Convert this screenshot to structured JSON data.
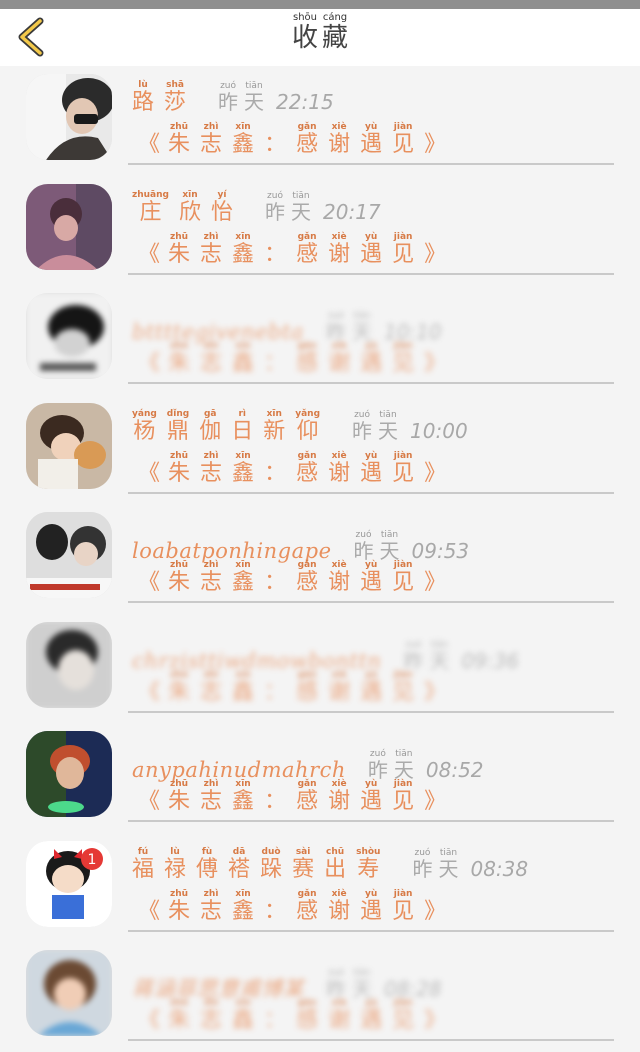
{
  "header": {
    "title_chars": [
      {
        "char": "收",
        "pinyin": "shōu"
      },
      {
        "char": "藏",
        "pinyin": "cáng"
      }
    ]
  },
  "message_chars": [
    {
      "char": "朱",
      "pinyin": "zhū"
    },
    {
      "char": "志",
      "pinyin": "zhì"
    },
    {
      "char": "鑫",
      "pinyin": "xīn"
    },
    {
      "char": "：",
      "pinyin": ""
    },
    {
      "char": "感",
      "pinyin": "gǎn"
    },
    {
      "char": "谢",
      "pinyin": "xiè"
    },
    {
      "char": "遇",
      "pinyin": "yù"
    },
    {
      "char": "见",
      "pinyin": "jiàn"
    }
  ],
  "yesterday_chars": [
    {
      "char": "昨",
      "pinyin": "zuó"
    },
    {
      "char": "天",
      "pinyin": "tiān"
    }
  ],
  "items": [
    {
      "name_chars": [
        {
          "char": "路",
          "pinyin": "lù"
        },
        {
          "char": "莎",
          "pinyin": "shā"
        }
      ],
      "time": "22:15",
      "blurred": false
    },
    {
      "name_chars": [
        {
          "char": "庄",
          "pinyin": "zhuāng"
        },
        {
          "char": "欣",
          "pinyin": "xīn"
        },
        {
          "char": "怡",
          "pinyin": "yí"
        }
      ],
      "time": "20:17",
      "blurred": false
    },
    {
      "name_latin": "bttttegivenebta",
      "time": "10:10",
      "blurred": true
    },
    {
      "name_chars": [
        {
          "char": "杨",
          "pinyin": "yáng"
        },
        {
          "char": "鼎",
          "pinyin": "dǐng"
        },
        {
          "char": "伽",
          "pinyin": "gā"
        },
        {
          "char": "日",
          "pinyin": "rì"
        },
        {
          "char": "新",
          "pinyin": "xīn"
        },
        {
          "char": "仰",
          "pinyin": "yǎng"
        }
      ],
      "time": "10:00",
      "blurred": false
    },
    {
      "name_latin": "loabatponhingape",
      "time": "09:53",
      "blurred": false
    },
    {
      "name_latin": "chrzisttiwdmowbonttn",
      "time": "09:36",
      "blurred": true
    },
    {
      "name_latin": "anypahinudmahrch",
      "time": "08:52",
      "blurred": false
    },
    {
      "name_chars": [
        {
          "char": "福",
          "pinyin": "fú"
        },
        {
          "char": "禄",
          "pinyin": "lù"
        },
        {
          "char": "傅",
          "pinyin": "fù"
        },
        {
          "char": "褡",
          "pinyin": "dā"
        },
        {
          "char": "跺",
          "pinyin": "duò"
        },
        {
          "char": "赛",
          "pinyin": "sài"
        },
        {
          "char": "出",
          "pinyin": "chū"
        },
        {
          "char": "寿",
          "pinyin": "shòu"
        }
      ],
      "time": "08:38",
      "blurred": false
    },
    {
      "name_latin": "蒋涵菲思意甫博某",
      "time": "08:28",
      "blurred": true
    }
  ]
}
